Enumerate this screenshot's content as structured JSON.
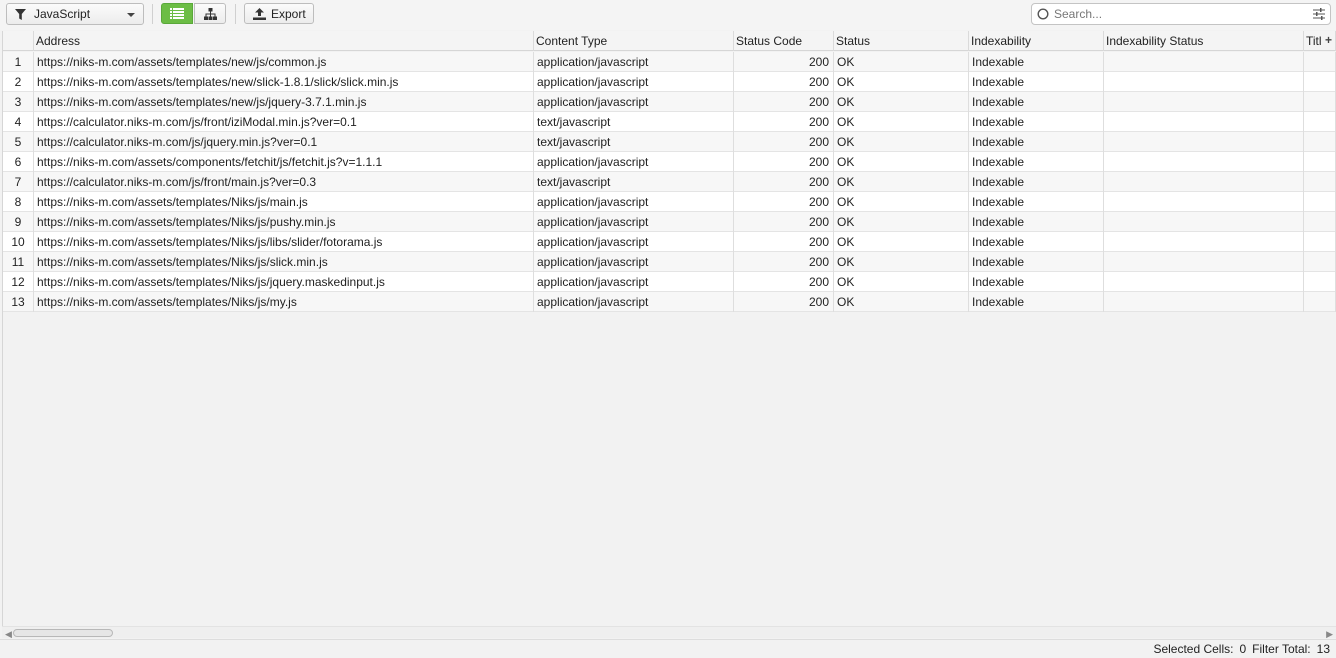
{
  "toolbar": {
    "filter_label": "JavaScript",
    "export_label": "Export",
    "accent_color": "#6cbd45"
  },
  "search": {
    "placeholder": "Search..."
  },
  "columns": {
    "address": "Address",
    "content_type": "Content Type",
    "status_code": "Status Code",
    "status": "Status",
    "indexability": "Indexability",
    "indexability_status": "Indexability Status",
    "title": "Titl"
  },
  "rows": [
    {
      "num": "1",
      "address": "https://niks-m.com/assets/templates/new/js/common.js",
      "content_type": "application/javascript",
      "status_code": "200",
      "status": "OK",
      "indexability": "Indexable",
      "indexability_status": ""
    },
    {
      "num": "2",
      "address": "https://niks-m.com/assets/templates/new/slick-1.8.1/slick/slick.min.js",
      "content_type": "application/javascript",
      "status_code": "200",
      "status": "OK",
      "indexability": "Indexable",
      "indexability_status": ""
    },
    {
      "num": "3",
      "address": "https://niks-m.com/assets/templates/new/js/jquery-3.7.1.min.js",
      "content_type": "application/javascript",
      "status_code": "200",
      "status": "OK",
      "indexability": "Indexable",
      "indexability_status": ""
    },
    {
      "num": "4",
      "address": "https://calculator.niks-m.com/js/front/iziModal.min.js?ver=0.1",
      "content_type": "text/javascript",
      "status_code": "200",
      "status": "OK",
      "indexability": "Indexable",
      "indexability_status": ""
    },
    {
      "num": "5",
      "address": "https://calculator.niks-m.com/js/jquery.min.js?ver=0.1",
      "content_type": "text/javascript",
      "status_code": "200",
      "status": "OK",
      "indexability": "Indexable",
      "indexability_status": ""
    },
    {
      "num": "6",
      "address": "https://niks-m.com/assets/components/fetchit/js/fetchit.js?v=1.1.1",
      "content_type": "application/javascript",
      "status_code": "200",
      "status": "OK",
      "indexability": "Indexable",
      "indexability_status": ""
    },
    {
      "num": "7",
      "address": "https://calculator.niks-m.com/js/front/main.js?ver=0.3",
      "content_type": "text/javascript",
      "status_code": "200",
      "status": "OK",
      "indexability": "Indexable",
      "indexability_status": ""
    },
    {
      "num": "8",
      "address": "https://niks-m.com/assets/templates/Niks/js/main.js",
      "content_type": "application/javascript",
      "status_code": "200",
      "status": "OK",
      "indexability": "Indexable",
      "indexability_status": ""
    },
    {
      "num": "9",
      "address": "https://niks-m.com/assets/templates/Niks/js/pushy.min.js",
      "content_type": "application/javascript",
      "status_code": "200",
      "status": "OK",
      "indexability": "Indexable",
      "indexability_status": ""
    },
    {
      "num": "10",
      "address": "https://niks-m.com/assets/templates/Niks/js/libs/slider/fotorama.js",
      "content_type": "application/javascript",
      "status_code": "200",
      "status": "OK",
      "indexability": "Indexable",
      "indexability_status": ""
    },
    {
      "num": "11",
      "address": "https://niks-m.com/assets/templates/Niks/js/slick.min.js",
      "content_type": "application/javascript",
      "status_code": "200",
      "status": "OK",
      "indexability": "Indexable",
      "indexability_status": ""
    },
    {
      "num": "12",
      "address": "https://niks-m.com/assets/templates/Niks/js/jquery.maskedinput.js",
      "content_type": "application/javascript",
      "status_code": "200",
      "status": "OK",
      "indexability": "Indexable",
      "indexability_status": ""
    },
    {
      "num": "13",
      "address": "https://niks-m.com/assets/templates/Niks/js/my.js",
      "content_type": "application/javascript",
      "status_code": "200",
      "status": "OK",
      "indexability": "Indexable",
      "indexability_status": ""
    }
  ],
  "statusbar": {
    "selected_label": "Selected Cells:",
    "selected_value": "0",
    "filter_label": "Filter Total:",
    "filter_value": "13"
  }
}
